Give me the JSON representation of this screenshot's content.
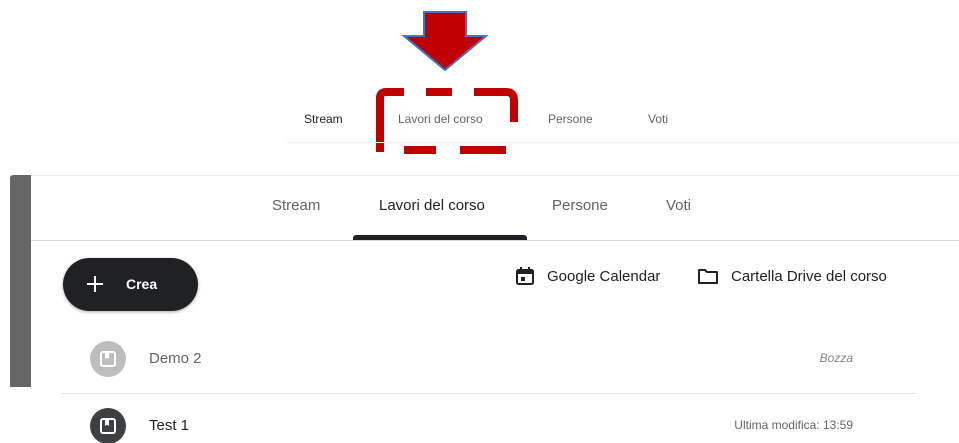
{
  "annotation": {
    "arrow_color": "#c00000",
    "arrow_outline": "#4472c4",
    "highlight_color": "#c00000"
  },
  "top_tabs": [
    "Stream",
    "Lavori del corso",
    "Persone",
    "Voti"
  ],
  "nav": {
    "tabs": [
      "Stream",
      "Lavori del corso",
      "Persone",
      "Voti"
    ],
    "active_index": 1
  },
  "toolbar": {
    "create_label": "Crea",
    "calendar_label": "Google Calendar",
    "drive_label": "Cartella Drive del corso"
  },
  "items": [
    {
      "title": "Demo 2",
      "meta": "Bozza",
      "state": "draft"
    },
    {
      "title": "Test 1",
      "meta": "Ultima modifica: 13:59",
      "state": "normal"
    }
  ],
  "colors": {
    "primary_dark": "#202124",
    "secondary_text": "#5f6368",
    "draft_avatar": "#bdbdbd",
    "item_avatar": "#3c4043"
  },
  "icons": {
    "create": "plus-icon",
    "calendar": "calendar-icon",
    "drive": "folder-icon",
    "item": "assignment-icon"
  }
}
